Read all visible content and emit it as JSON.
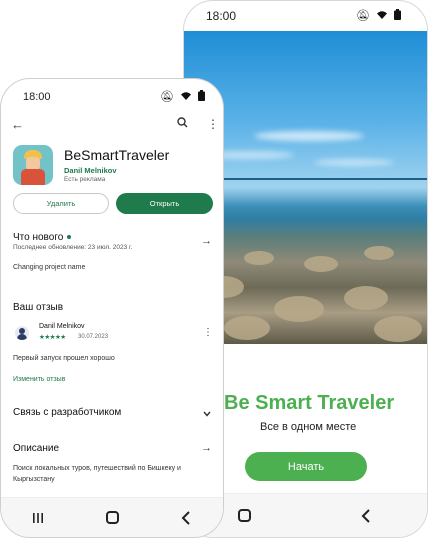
{
  "back_phone": {
    "status_time": "18:00",
    "status_icons": [
      "mute-icon",
      "wifi-icon",
      "battery-icon"
    ],
    "splash_title": "Be Smart Traveler",
    "splash_subtitle": "Все в одном месте",
    "start_button": "Начать",
    "nav": [
      "recent-apps-icon",
      "home-icon",
      "back-icon"
    ]
  },
  "front_phone": {
    "status_time": "18:00",
    "status_icons": [
      "mute-icon",
      "wifi-icon",
      "battery-icon"
    ],
    "app": {
      "name": "BeSmartTraveler",
      "developer": "Danil Melnikov",
      "ads_note": "Есть реклама"
    },
    "buttons": {
      "uninstall": "Удалить",
      "open": "Открыть"
    },
    "whats_new": {
      "title": "Что нового",
      "updated": "Последнее обновление: 23 июл. 2023 г.",
      "note": "Changing project name"
    },
    "your_review": {
      "title": "Ваш отзыв",
      "reviewer": "Danil Melnikov",
      "stars": "★★★★★",
      "rating": 5,
      "date": "30.07.2023",
      "text": "Первый запуск прошел хорошо",
      "edit_link": "Изменить отзыв"
    },
    "developer_contact": {
      "title": "Связь с разработчиком"
    },
    "description": {
      "title": "Описание",
      "text": "Поиск локальных туров, путешествий по Бишкеку и Кыргызстану"
    },
    "nav": [
      "recent-apps-icon",
      "home-icon",
      "back-icon"
    ]
  },
  "colors": {
    "brand_green": "#4caf50",
    "play_green": "#1f7a4c"
  }
}
